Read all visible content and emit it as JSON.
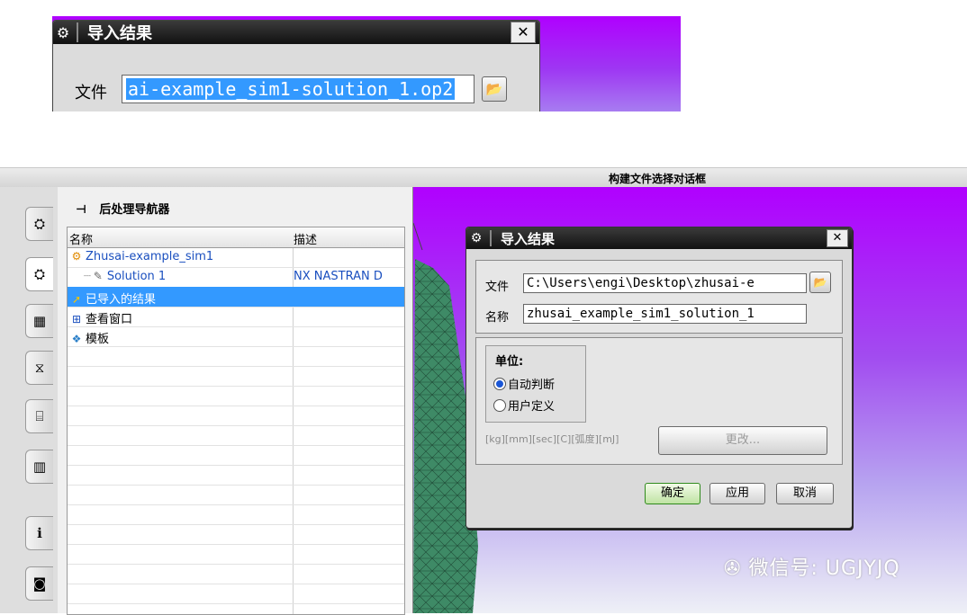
{
  "top_snippet": {
    "title": "导入结果",
    "file_label": "文件",
    "file_value": "ai-example_sim1-solution_1.op2",
    "gear_icon": "gear-icon",
    "close_icon": "close-icon",
    "close_glyph": "✕"
  },
  "window": {
    "title": "构建文件选择对话框"
  },
  "left_tabs": [
    "part-navigator-icon",
    "sim-navigator-icon",
    "assembly-navigator-icon",
    "constraint-navigator-icon",
    "reuse-library-icon",
    "history-icon",
    "web-help-icon",
    "roles-icon"
  ],
  "navigator": {
    "pin_glyph": "⊣",
    "title": "后处理导航器",
    "columns": [
      "名称",
      "描述"
    ],
    "rows": [
      {
        "name": "Zhusai-example_sim1",
        "desc": "",
        "icon": "sim-file-icon",
        "indent": 0,
        "selected": false
      },
      {
        "name": "Solution 1",
        "desc": "NX NASTRAN D",
        "icon": "solution-icon",
        "indent": 2,
        "selected": false
      },
      {
        "name": "已导入的结果",
        "desc": "",
        "icon": "imported-results-icon",
        "indent": 0,
        "selected": true
      },
      {
        "name": "查看窗口",
        "desc": "",
        "icon": "viewport-icon",
        "indent": 0,
        "selected": false
      },
      {
        "name": "模板",
        "desc": "",
        "icon": "template-icon",
        "indent": 0,
        "selected": false
      }
    ]
  },
  "dialog": {
    "title": "导入结果",
    "file_label": "文件",
    "file_value": "C:\\Users\\engi\\Desktop\\zhusai-e",
    "name_label": "名称",
    "name_value": "zhusai_example_sim1_solution_1",
    "units_label": "单位:",
    "radio_auto": "自动判断",
    "radio_user": "用户定义",
    "units_text": "[kg][mm][sec][C][弧度][mJ]",
    "change_button": "更改...",
    "ok_button": "确定",
    "apply_button": "应用",
    "cancel_button": "取消",
    "close_glyph": "✕"
  },
  "watermark": "微信号: UGJYJQ",
  "colors": {
    "viewport_top": "#b000ff",
    "selection": "#3399ff",
    "mesh": "#2e6b4f"
  }
}
